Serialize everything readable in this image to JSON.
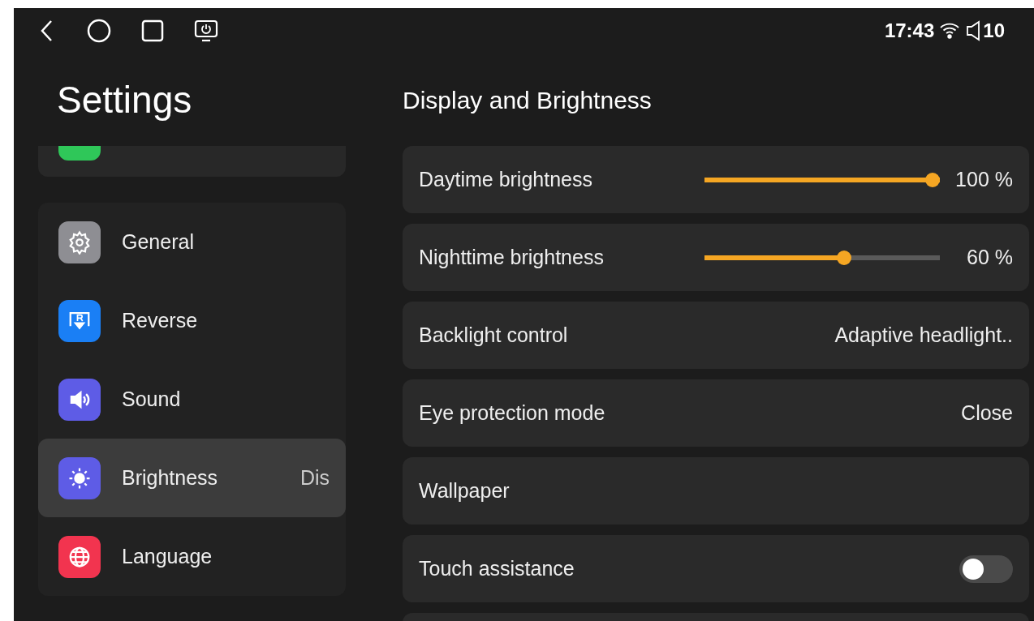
{
  "status_bar": {
    "time": "17:43",
    "volume": "10"
  },
  "sidebar": {
    "title": "Settings",
    "partial_item": {
      "color": "#2fc759"
    },
    "items": [
      {
        "label": "General",
        "color": "#8e8e93",
        "selected": false
      },
      {
        "label": "Reverse",
        "color": "#1a7ff5",
        "selected": false
      },
      {
        "label": "Sound",
        "color": "#5e5ce6",
        "selected": false
      },
      {
        "label": "Brightness",
        "color": "#5e5ce6",
        "selected": true,
        "trailing": "Dis"
      },
      {
        "label": "Language",
        "color": "#f2344f",
        "selected": false
      }
    ]
  },
  "content": {
    "title": "Display and Brightness",
    "rows": [
      {
        "kind": "slider",
        "label": "Daytime brightness",
        "level": 1.0,
        "reading": "100 %"
      },
      {
        "kind": "slider",
        "label": "Nighttime brightness",
        "level": 0.6,
        "reading": "60 %"
      },
      {
        "kind": "value",
        "label": "Backlight control",
        "value": "Adaptive headlight.."
      },
      {
        "kind": "value",
        "label": "Eye protection mode",
        "value": "Close"
      },
      {
        "kind": "link",
        "label": "Wallpaper"
      },
      {
        "kind": "toggle",
        "label": "Touch assistance",
        "on": false
      }
    ]
  }
}
